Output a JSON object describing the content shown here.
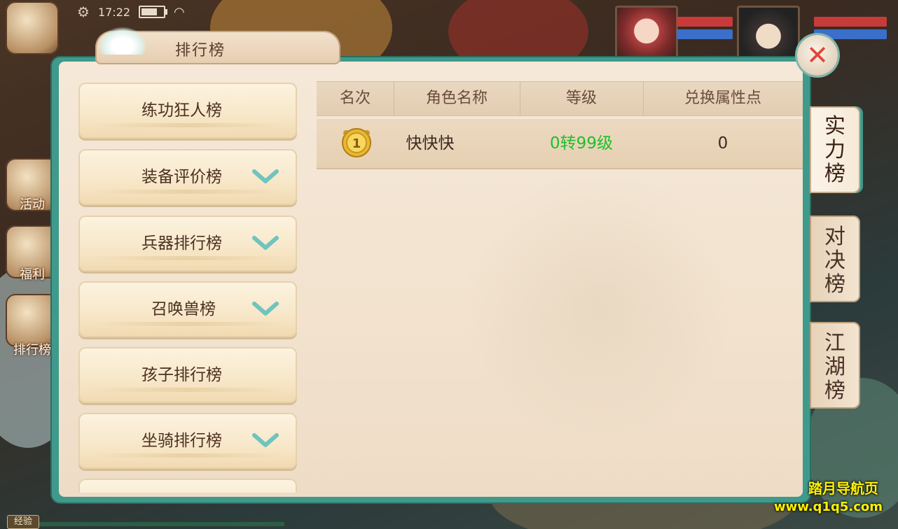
{
  "status_bar": {
    "time": "17:22"
  },
  "background": {
    "left_icons": [
      {
        "label": "活动"
      },
      {
        "label": "福利"
      },
      {
        "label": "排行榜"
      }
    ],
    "exp_label": "经验",
    "watermark_name": "踏月导航页",
    "watermark_url": "www.q1q5.com"
  },
  "panel": {
    "title": "排行榜",
    "categories": [
      {
        "label": "练功狂人榜",
        "has_chevron": false
      },
      {
        "label": "装备评价榜",
        "has_chevron": true
      },
      {
        "label": "兵器排行榜",
        "has_chevron": true
      },
      {
        "label": "召唤兽榜",
        "has_chevron": true
      },
      {
        "label": "孩子排行榜",
        "has_chevron": false
      },
      {
        "label": "坐骑排行榜",
        "has_chevron": true
      },
      {
        "label": "",
        "has_chevron": false
      }
    ],
    "table": {
      "headers": [
        "名次",
        "角色名称",
        "等级",
        "兑换属性点"
      ],
      "rows": [
        {
          "rank": "1",
          "name": "快快快",
          "level": "0转99级",
          "points": "0"
        }
      ]
    },
    "side_tabs": [
      {
        "label": "实力榜",
        "active": true
      },
      {
        "label": "对决榜",
        "active": false
      },
      {
        "label": "江湖榜",
        "active": false
      }
    ]
  },
  "colors": {
    "level_text": "#1fbf2a",
    "frame": "#3f9a8c",
    "close_x": "#e0463a",
    "chevron": "#6fc4be"
  }
}
